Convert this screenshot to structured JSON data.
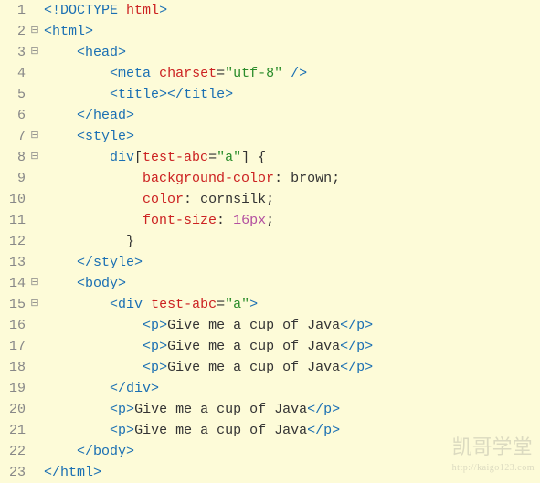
{
  "gutter": {
    "lines": [
      "1",
      "2",
      "3",
      "4",
      "5",
      "6",
      "7",
      "8",
      "9",
      "10",
      "11",
      "12",
      "13",
      "14",
      "15",
      "16",
      "17",
      "18",
      "19",
      "20",
      "21",
      "22",
      "23"
    ],
    "fold": [
      "",
      "⊟",
      "⊟",
      "",
      "",
      "",
      "⊟",
      "⊟",
      "",
      "",
      "",
      "",
      "",
      "⊟",
      "⊟",
      "",
      "",
      "",
      "",
      "",
      "",
      "",
      ""
    ]
  },
  "code": {
    "l1": {
      "t1": "<!",
      "t2": "DOCTYPE",
      "sp": " ",
      "t3": "html",
      "t4": ">"
    },
    "l2": {
      "t1": "<",
      "t2": "html",
      "t3": ">"
    },
    "l3": {
      "ind": "    ",
      "t1": "<",
      "t2": "head",
      "t3": ">"
    },
    "l4": {
      "ind": "        ",
      "t1": "<",
      "t2": "meta",
      "sp": " ",
      "a1": "charset",
      "eq": "=",
      "q1": "\"",
      "v1": "utf-8",
      "q2": "\"",
      "sp2": " ",
      "t3": "/>"
    },
    "l5": {
      "ind": "        ",
      "t1": "<",
      "t2": "title",
      "t3": "></",
      "t4": "title",
      "t5": ">"
    },
    "l6": {
      "ind": "    ",
      "t1": "</",
      "t2": "head",
      "t3": ">"
    },
    "l7": {
      "ind": "    ",
      "t1": "<",
      "t2": "style",
      "t3": ">"
    },
    "l8": {
      "ind": "        ",
      "sel": "div",
      "br1": "[",
      "a1": "test-abc",
      "eq": "=",
      "q1": "\"",
      "v1": "a",
      "q2": "\"",
      "br2": "]",
      "sp": " ",
      "ob": "{"
    },
    "l9": {
      "ind": "            ",
      "p": "background-color",
      "c": ":",
      "sp": " ",
      "v": "brown",
      "sc": ";"
    },
    "l10": {
      "ind": "            ",
      "p": "color",
      "c": ":",
      "sp": " ",
      "v": "cornsilk",
      "sc": ";"
    },
    "l11": {
      "ind": "            ",
      "p": "font-size",
      "c": ":",
      "sp": " ",
      "v": "16",
      "u": "px",
      "sc": ";"
    },
    "l12": {
      "ind": "          ",
      "cb": "}"
    },
    "l13": {
      "ind": "    ",
      "t1": "</",
      "t2": "style",
      "t3": ">"
    },
    "l14": {
      "ind": "    ",
      "t1": "<",
      "t2": "body",
      "t3": ">"
    },
    "l15": {
      "ind": "        ",
      "t1": "<",
      "t2": "div",
      "sp": " ",
      "a1": "test-abc",
      "eq": "=",
      "q1": "\"",
      "v1": "a",
      "q2": "\"",
      "t3": ">"
    },
    "l16": {
      "ind": "            ",
      "t1": "<",
      "t2": "p",
      "t3": ">",
      "txt": "Give me a cup of Java",
      "t4": "</",
      "t5": "p",
      "t6": ">"
    },
    "l17": {
      "ind": "            ",
      "t1": "<",
      "t2": "p",
      "t3": ">",
      "txt": "Give me a cup of Java",
      "t4": "</",
      "t5": "p",
      "t6": ">"
    },
    "l18": {
      "ind": "            ",
      "t1": "<",
      "t2": "p",
      "t3": ">",
      "txt": "Give me a cup of Java",
      "t4": "</",
      "t5": "p",
      "t6": ">"
    },
    "l19": {
      "ind": "        ",
      "t1": "</",
      "t2": "div",
      "t3": ">"
    },
    "l20": {
      "ind": "        ",
      "t1": "<",
      "t2": "p",
      "t3": ">",
      "txt": "Give me a cup of Java",
      "t4": "</",
      "t5": "p",
      "t6": ">"
    },
    "l21": {
      "ind": "        ",
      "t1": "<",
      "t2": "p",
      "t3": ">",
      "txt": "Give me a cup of Java",
      "t4": "</",
      "t5": "p",
      "t6": ">"
    },
    "l22": {
      "ind": "    ",
      "t1": "</",
      "t2": "body",
      "t3": ">"
    },
    "l23": {
      "t1": "</",
      "t2": "html",
      "t3": ">"
    }
  },
  "watermark": {
    "main": "凯哥学堂",
    "sub": "http://kaigo123.com"
  }
}
